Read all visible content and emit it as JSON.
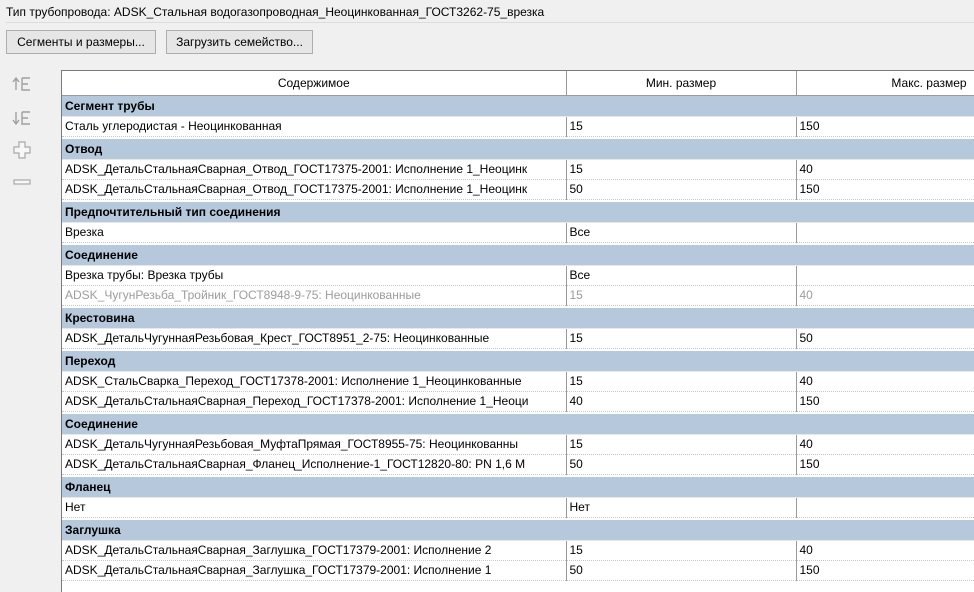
{
  "header": {
    "title": "Тип трубопровода: ADSK_Стальная водогазопроводная_Неоцинкованная_ГОСТ3262-75_врезка"
  },
  "buttons": {
    "segments": "Сегменты и размеры...",
    "load_family": "Загрузить семейство..."
  },
  "toolbox": {
    "icons": [
      "move-up-icon",
      "move-down-icon",
      "add-row-icon",
      "remove-row-icon"
    ]
  },
  "table": {
    "columns": [
      "Содержимое",
      "Мин. размер",
      "Макс. размер"
    ],
    "groups": [
      {
        "name": "Сегмент трубы",
        "rows": [
          [
            "Сталь углеродистая - Неоцинкованная",
            "15",
            "150"
          ]
        ]
      },
      {
        "name": "Отвод",
        "rows": [
          [
            "ADSK_ДетальСтальнаяСварная_Отвод_ГОСТ17375-2001: Исполнение 1_Неоцинк",
            "15",
            "40"
          ],
          [
            "ADSK_ДетальСтальнаяСварная_Отвод_ГОСТ17375-2001: Исполнение 1_Неоцинк",
            "50",
            "150"
          ]
        ]
      },
      {
        "name": "Предпочтительный тип соединения",
        "rows": [
          [
            "Врезка",
            "Все",
            ""
          ]
        ]
      },
      {
        "name": "Соединение",
        "rows": [
          [
            "Врезка трубы: Врезка трубы",
            "Все",
            ""
          ],
          [
            "ADSK_ЧугунРезьба_Тройник_ГОСТ8948-9-75: Неоцинкованные",
            "15",
            "40",
            "disabled"
          ]
        ]
      },
      {
        "name": "Крестовина",
        "rows": [
          [
            "ADSK_ДетальЧугуннаяРезьбовая_Крест_ГОСТ8951_2-75: Неоцинкованные",
            "15",
            "50"
          ]
        ]
      },
      {
        "name": "Переход",
        "rows": [
          [
            "ADSK_СтальСварка_Переход_ГОСТ17378-2001: Исполнение 1_Неоцинкованные",
            "15",
            "40"
          ],
          [
            "ADSK_ДетальСтальнаяСварная_Переход_ГОСТ17378-2001: Исполнение 1_Неоци",
            "40",
            "150"
          ]
        ]
      },
      {
        "name": "Соединение",
        "rows": [
          [
            "ADSK_ДетальЧугуннаяРезьбовая_МуфтаПрямая_ГОСТ8955-75: Неоцинкованны",
            "15",
            "40"
          ],
          [
            "ADSK_ДетальСтальнаяСварная_Фланец_Исполнение-1_ГОСТ12820-80: PN 1,6 М",
            "50",
            "150"
          ]
        ]
      },
      {
        "name": "Фланец",
        "rows": [
          [
            "Нет",
            "Нет",
            ""
          ]
        ]
      },
      {
        "name": "Заглушка",
        "rows": [
          [
            "ADSK_ДетальСтальнаяСварная_Заглушка_ГОСТ17379-2001: Исполнение 2",
            "15",
            "40"
          ],
          [
            "ADSK_ДетальСтальнаяСварная_Заглушка_ГОСТ17379-2001: Исполнение 1",
            "50",
            "150"
          ]
        ]
      }
    ]
  },
  "colors": {
    "group_header_bg": "#b6c8dc",
    "disabled_text": "#9c9c9c"
  }
}
